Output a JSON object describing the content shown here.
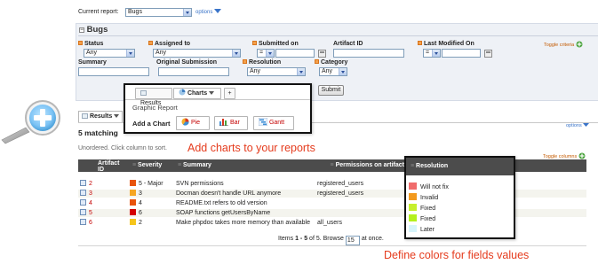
{
  "report_bar": {
    "label": "Current report:",
    "value": "Bugs",
    "options_link": "options"
  },
  "section_title": "Bugs",
  "toggle_criteria": "Toggle criteria",
  "filters": {
    "status": {
      "label": "Status",
      "value": "Any"
    },
    "assigned_to": {
      "label": "Assigned to",
      "value": "Any"
    },
    "submitted_on": {
      "label": "Submitted on",
      "op": "="
    },
    "artifact_id": {
      "label": "Artifact ID"
    },
    "last_modified_on": {
      "label": "Last Modified On",
      "op": "="
    },
    "summary": {
      "label": "Summary"
    },
    "original_submission": {
      "label": "Original Submission"
    },
    "resolution": {
      "label": "Resolution",
      "value": "Any"
    },
    "category": {
      "label": "Category",
      "value": "Any"
    }
  },
  "submit_label": "Submit",
  "results_tab": "Results",
  "popup": {
    "tab_results": "Results",
    "tab_charts": "Charts",
    "tab_add": "+",
    "graphic_report": "Graphic Report",
    "add_chart_label": "Add a Chart",
    "buttons": [
      "Pie",
      "Bar",
      "Gantt"
    ]
  },
  "matching": "5 matching",
  "unordered_text": "Unordered. Click column to sort.",
  "toggle_columns": "Toggle columns",
  "options_right": "options",
  "annotation_charts": "Add charts to your reports",
  "annotation_colors": "Define colors for fields values",
  "table": {
    "headers": {
      "artifact_id": "Artifact ID",
      "severity": "Severity",
      "summary": "Summary",
      "permissions": "Permissions on artifact"
    },
    "rows": [
      {
        "id": "2",
        "severity": "5 - Major",
        "sev_color": "#e8530c",
        "summary": "SVN permissions",
        "permissions": "registered_users"
      },
      {
        "id": "3",
        "severity": "3",
        "sev_color": "#f6a623",
        "summary": "Docman doesn't handle URL anymore",
        "permissions": "registered_users"
      },
      {
        "id": "4",
        "severity": "4",
        "sev_color": "#e8530c",
        "summary": "README.txt refers to old version",
        "permissions": ""
      },
      {
        "id": "5",
        "severity": "6",
        "sev_color": "#d40000",
        "summary": "SOAP functions getUsersByName",
        "permissions": ""
      },
      {
        "id": "6",
        "severity": "2",
        "sev_color": "#f6c51b",
        "summary": "Make phpdoc takes more memory than available",
        "permissions": "all_users"
      }
    ]
  },
  "pagination": {
    "prefix": "Items",
    "range": "1 - 5",
    "of_text": "of 5. Browse",
    "per_page": "15",
    "suffix": "at once."
  },
  "resolution_popup": {
    "header": "Resolution",
    "items": [
      {
        "label": "Will not fix",
        "color": "#f06c6c"
      },
      {
        "label": "Invalid",
        "color": "#f39a1e"
      },
      {
        "label": "Fixed",
        "color": "#c6ef2c"
      },
      {
        "label": "Fixed",
        "color": "#b4f01e"
      },
      {
        "label": "Later",
        "color": "#d6f4fb"
      }
    ]
  }
}
